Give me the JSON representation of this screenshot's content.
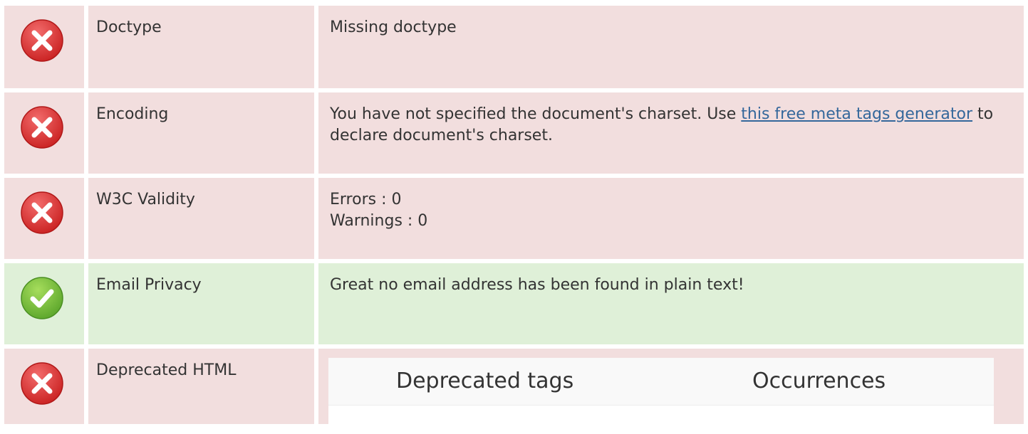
{
  "colors": {
    "fail_bg": "#f2dede",
    "pass_bg": "#dff0d8",
    "fail_icon": "#e03b3b",
    "pass_icon": "#6bb536",
    "link": "#34679b"
  },
  "rows": [
    {
      "status": "fail",
      "status_icon": "error-x-icon",
      "name": "Doctype",
      "value": "Missing doctype"
    },
    {
      "status": "fail",
      "status_icon": "error-x-icon",
      "name": "Encoding",
      "value_before": "You have not specified the document's charset. Use ",
      "link_text": "this free meta tags generator",
      "value_after": " to declare document's charset."
    },
    {
      "status": "fail",
      "status_icon": "error-x-icon",
      "name": "W3C Validity",
      "errors": "Errors : 0",
      "warnings": "Warnings : 0"
    },
    {
      "status": "pass",
      "status_icon": "check-icon",
      "name": "Email Privacy",
      "value": "Great no email address has been found in plain text!"
    },
    {
      "status": "fail",
      "status_icon": "error-x-icon",
      "name": "Deprecated HTML",
      "table": {
        "col1": "Deprecated tags",
        "col2": "Occurrences"
      }
    }
  ]
}
